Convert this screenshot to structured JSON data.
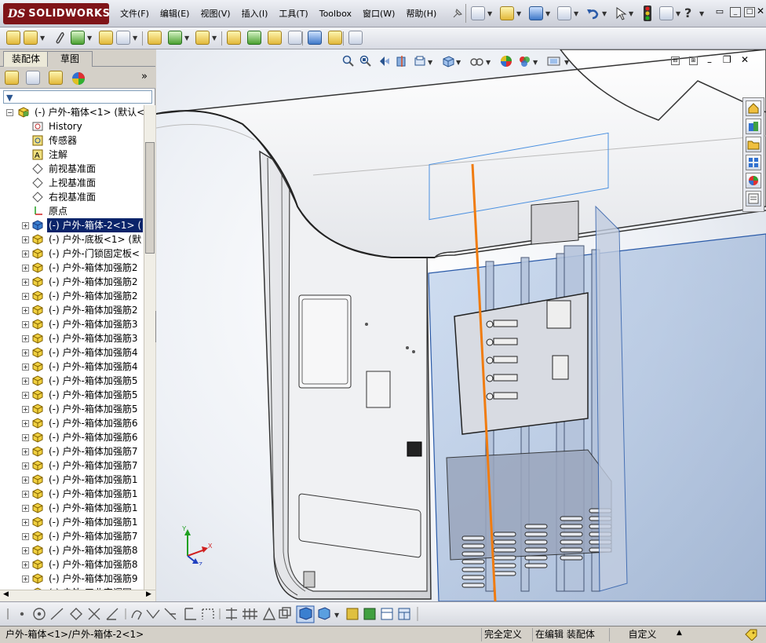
{
  "app": {
    "logo_ds": "DS",
    "logo_name": "SOLIDWORKS"
  },
  "menu": [
    "文件(F)",
    "编辑(E)",
    "视图(V)",
    "插入(I)",
    "工具(T)",
    "Toolbox",
    "窗口(W)",
    "帮助(H)"
  ],
  "window_buttons": [
    "restore-icon",
    "minimize-icon",
    "maximize-icon",
    "close-icon"
  ],
  "panel": {
    "tabs": [
      "装配体",
      "草图"
    ],
    "active_tab": 0,
    "filter_placeholder": ""
  },
  "tree": {
    "root": "(-) 户外-箱体<1> (默认<",
    "items": [
      {
        "label": "History",
        "icon": "history-icon"
      },
      {
        "label": "传感器",
        "icon": "sensor-icon"
      },
      {
        "label": "注解",
        "icon": "annotation-icon"
      },
      {
        "label": "前视基准面",
        "icon": "plane-icon"
      },
      {
        "label": "上视基准面",
        "icon": "plane-icon"
      },
      {
        "label": "右视基准面",
        "icon": "plane-icon"
      },
      {
        "label": "原点",
        "icon": "origin-icon"
      },
      {
        "label": "(-) 户外-箱体-2<1> (",
        "icon": "part-icon",
        "selected": true
      },
      {
        "label": "(-) 户外-底板<1> (默",
        "icon": "part-icon"
      },
      {
        "label": "(-) 户外-门锁固定板<",
        "icon": "part-icon"
      },
      {
        "label": "(-) 户外-箱体加强筋2",
        "icon": "part-icon"
      },
      {
        "label": "(-) 户外-箱体加强筋2",
        "icon": "part-icon"
      },
      {
        "label": "(-) 户外-箱体加强筋2",
        "icon": "part-icon"
      },
      {
        "label": "(-) 户外-箱体加强筋2",
        "icon": "part-icon"
      },
      {
        "label": "(-) 户外-箱体加强筋3",
        "icon": "part-icon"
      },
      {
        "label": "(-) 户外-箱体加强筋3",
        "icon": "part-icon"
      },
      {
        "label": "(-) 户外-箱体加强筋4",
        "icon": "part-icon"
      },
      {
        "label": "(-) 户外-箱体加强筋4",
        "icon": "part-icon"
      },
      {
        "label": "(-) 户外-箱体加强筋5",
        "icon": "part-icon"
      },
      {
        "label": "(-) 户外-箱体加强筋5",
        "icon": "part-icon"
      },
      {
        "label": "(-) 户外-箱体加强筋5",
        "icon": "part-icon"
      },
      {
        "label": "(-) 户外-箱体加强筋6",
        "icon": "part-icon"
      },
      {
        "label": "(-) 户外-箱体加强筋6",
        "icon": "part-icon"
      },
      {
        "label": "(-) 户外-箱体加强筋7",
        "icon": "part-icon"
      },
      {
        "label": "(-) 户外-箱体加强筋7",
        "icon": "part-icon"
      },
      {
        "label": "(-) 户外-箱体加强筋1",
        "icon": "part-icon"
      },
      {
        "label": "(-) 户外-箱体加强筋1",
        "icon": "part-icon"
      },
      {
        "label": "(-) 户外-箱体加强筋1",
        "icon": "part-icon"
      },
      {
        "label": "(-) 户外-箱体加强筋1",
        "icon": "part-icon"
      },
      {
        "label": "(-) 户外-箱体加强筋7",
        "icon": "part-icon"
      },
      {
        "label": "(-) 户外-箱体加强筋8",
        "icon": "part-icon"
      },
      {
        "label": "(-) 户外-箱体加强筋8",
        "icon": "part-icon"
      },
      {
        "label": "(-) 户外-箱体加强筋9",
        "icon": "part-icon"
      },
      {
        "label": "(-) 户外-工业空调固",
        "icon": "part-icon"
      }
    ]
  },
  "triad": {
    "x": "X",
    "y": "Y",
    "z": "Z"
  },
  "status": {
    "path": "户外-箱体<1>/户外-箱体-2<1>",
    "definition": "完全定义",
    "editing": "在编辑 装配体",
    "units": "自定义"
  },
  "colors": {
    "logo": "#7f1418",
    "selection": "#0a246a",
    "sketch_line": "#f07c10",
    "glass": "#4a90e0"
  }
}
